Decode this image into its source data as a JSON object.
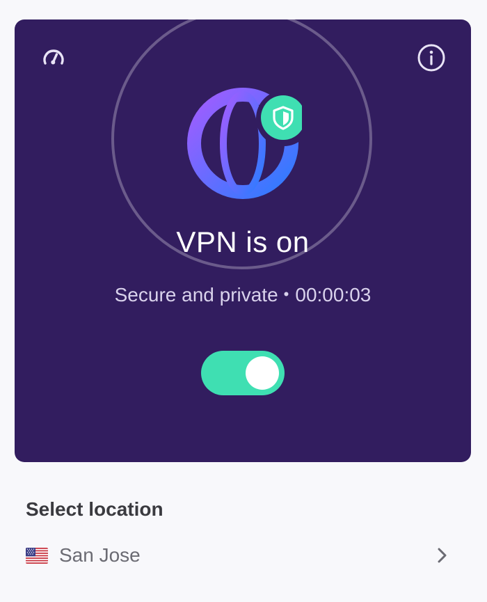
{
  "vpn": {
    "status_title": "VPN is on",
    "status_detail": "Secure and private",
    "separator": "•",
    "timer": "00:00:03",
    "toggle_on": true,
    "colors": {
      "card_background": "#321d5f",
      "toggle_on": "#3fdfb2",
      "shield_badge": "#3fdfb2",
      "globe_gradient_start": "#9b5cff",
      "globe_gradient_end": "#2f7bff"
    },
    "icons": {
      "top_left": "speedometer-icon",
      "top_right": "info-icon",
      "center": "globe-icon",
      "badge": "shield-icon"
    }
  },
  "location": {
    "heading": "Select location",
    "selected": "San Jose",
    "flag": "us-flag-icon",
    "action_icon": "chevron-right-icon"
  }
}
